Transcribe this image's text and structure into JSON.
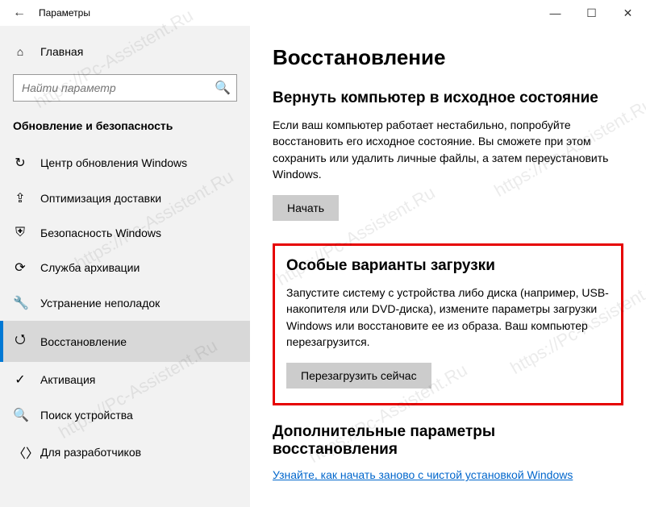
{
  "window": {
    "title": "Параметры"
  },
  "sidebar": {
    "home": "Главная",
    "search_placeholder": "Найти параметр",
    "section": "Обновление и безопасность",
    "items": [
      {
        "icon": "↻",
        "label": "Центр обновления Windows"
      },
      {
        "icon": "⇪",
        "label": "Оптимизация доставки"
      },
      {
        "icon": "⛨",
        "label": "Безопасность Windows"
      },
      {
        "icon": "⟳",
        "label": "Служба архивации"
      },
      {
        "icon": "🔧",
        "label": "Устранение неполадок"
      },
      {
        "icon": "⭯",
        "label": "Восстановление"
      },
      {
        "icon": "✓",
        "label": "Активация"
      },
      {
        "icon": "🔍",
        "label": "Поиск устройства"
      },
      {
        "icon": "〈〉",
        "label": "Для разработчиков"
      }
    ]
  },
  "main": {
    "title": "Восстановление",
    "reset": {
      "heading": "Вернуть компьютер в исходное состояние",
      "body": "Если ваш компьютер работает нестабильно, попробуйте восстановить его исходное состояние. Вы сможете при этом сохранить или удалить личные файлы, а затем переустановить Windows.",
      "button": "Начать"
    },
    "advanced": {
      "heading": "Особые варианты загрузки",
      "body": "Запустите систему с устройства либо диска (например, USB-накопителя или DVD-диска), измените параметры загрузки Windows или восстановите ее из образа. Ваш компьютер перезагрузится.",
      "button": "Перезагрузить сейчас"
    },
    "more": {
      "heading": "Дополнительные параметры восстановления",
      "link": "Узнайте, как начать заново с чистой установкой Windows"
    }
  },
  "watermark": "https://Pc-Assistent.Ru"
}
